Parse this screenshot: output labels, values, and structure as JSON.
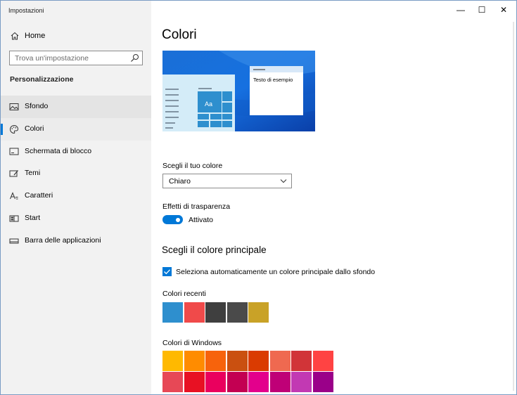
{
  "window": {
    "app_title": "Impostazioni",
    "controls": {
      "minimize": "—",
      "maximize": "☐",
      "close": "✕"
    }
  },
  "sidebar": {
    "home_label": "Home",
    "search_placeholder": "Trova un'impostazione",
    "section_title": "Personalizzazione",
    "items": [
      {
        "label": "Sfondo",
        "icon": "image-icon"
      },
      {
        "label": "Colori",
        "icon": "palette-icon"
      },
      {
        "label": "Schermata di blocco",
        "icon": "lock-screen-icon"
      },
      {
        "label": "Temi",
        "icon": "themes-icon"
      },
      {
        "label": "Caratteri",
        "icon": "font-icon"
      },
      {
        "label": "Start",
        "icon": "start-icon"
      },
      {
        "label": "Barra delle applicazioni",
        "icon": "taskbar-icon"
      }
    ],
    "selected_index": 1
  },
  "main": {
    "title": "Colori",
    "preview": {
      "tile_text": "Aa",
      "sample_text": "Testo di esempio"
    },
    "choose_color_label": "Scegli il tuo colore",
    "choose_color_value": "Chiaro",
    "transparency_label": "Effetti di trasparenza",
    "transparency_state": "Attivato",
    "accent_heading": "Scegli il colore principale",
    "auto_accent_label": "Seleziona automaticamente un colore principale dallo sfondo",
    "auto_accent_checked": true,
    "recent_colors_label": "Colori recenti",
    "recent_colors": [
      "#2e8fce",
      "#f04a4a",
      "#3f3f3f",
      "#4a4a4a",
      "#c9a227"
    ],
    "windows_colors_label": "Colori di Windows",
    "windows_colors_row1": [
      "#ffb900",
      "#ff8c00",
      "#f7630c",
      "#ca5010",
      "#da3b01",
      "#ef6950",
      "#d13438",
      "#ff4343"
    ],
    "windows_colors_row2": [
      "#e74856",
      "#e81123",
      "#ea005e",
      "#c30052",
      "#e3008c",
      "#bf0077",
      "#c239b3",
      "#9a0089"
    ]
  },
  "colors": {
    "accent": "#0078d7",
    "sidebar_bg": "#f2f2f2"
  }
}
